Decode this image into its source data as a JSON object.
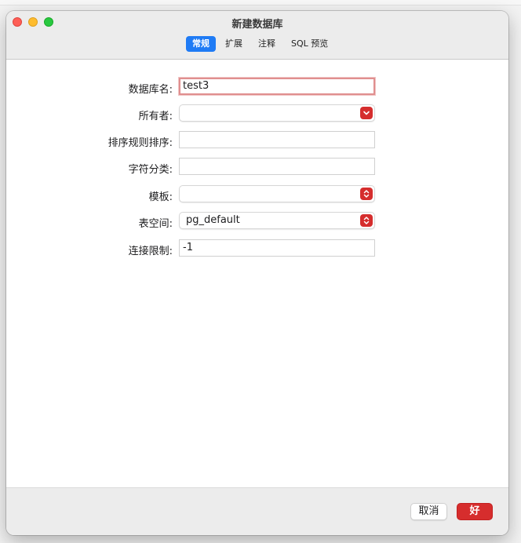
{
  "window": {
    "title": "新建数据库"
  },
  "tabs": [
    {
      "label": "常规",
      "active": true
    },
    {
      "label": "扩展",
      "active": false
    },
    {
      "label": "注释",
      "active": false
    },
    {
      "label": "SQL 预览",
      "active": false
    }
  ],
  "form": {
    "db_name": {
      "label": "数据库名:",
      "value": "test3"
    },
    "owner": {
      "label": "所有者:",
      "value": ""
    },
    "collation": {
      "label": "排序规则排序:",
      "value": ""
    },
    "ctype": {
      "label": "字符分类:",
      "value": ""
    },
    "template": {
      "label": "模板:",
      "value": ""
    },
    "tablespace": {
      "label": "表空间:",
      "value": "pg_default"
    },
    "conn_limit": {
      "label": "连接限制:",
      "value": "-1"
    }
  },
  "footer": {
    "cancel_label": "取消",
    "ok_label": "好"
  },
  "colors": {
    "accent": "#d62d2d",
    "tab_active": "#1f7bf5"
  },
  "icons": {
    "owner_dropdown": "chevron-down-icon",
    "template_dropdown": "up-down-chevron-icon",
    "tablespace_dropdown": "up-down-chevron-icon"
  }
}
